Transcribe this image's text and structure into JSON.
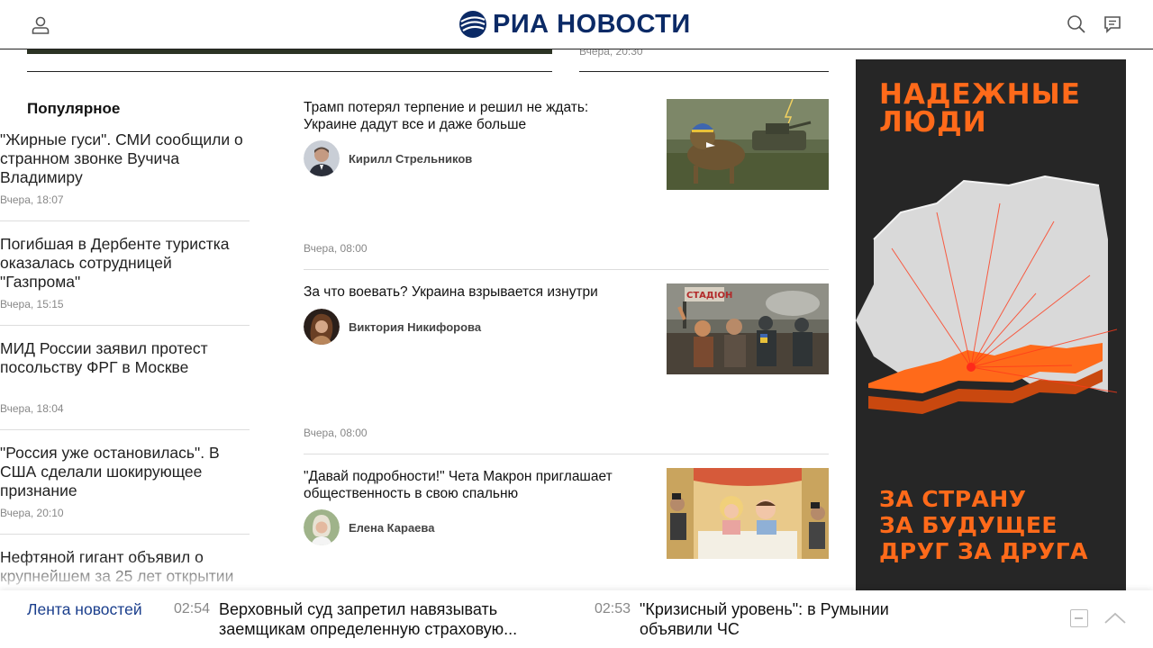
{
  "header": {
    "logo_text": "РИА НОВОСТИ",
    "brand_color": "#0b2a66",
    "icons": [
      "user-icon",
      "search-icon",
      "chat-icon"
    ]
  },
  "previous_row": {
    "time": "Вчера, 20:30"
  },
  "popular": {
    "title": "Популярное",
    "items": [
      {
        "title": "\"Жирные гуси\". СМИ сообщили о странном звонке Вучича Владимиру",
        "time": "Вчера, 18:07"
      },
      {
        "title": "Погибшая в Дербенте туристка оказалась сотрудницей \"Газпрома\"",
        "time": "Вчера, 15:15"
      },
      {
        "title": "МИД России заявил протест посольству ФРГ в Москве",
        "time": "Вчера, 18:04"
      },
      {
        "title": "\"Россия уже остановилась\". В США сделали шокирующее признание",
        "time": "Вчера, 20:10"
      },
      {
        "title": "Нефтяной гигант объявил о крупнейшем за 25 лет открытии",
        "time": ""
      }
    ]
  },
  "news": [
    {
      "title": "Трамп потерял терпение и решил не ждать: Украине дадут все и даже больше",
      "author": "Кирилл Стрельников",
      "time": "Вчера, 08:00"
    },
    {
      "title": "За что воевать? Украина взрывается изнутри",
      "author": "Виктория Никифорова",
      "time": "Вчера, 08:00",
      "image_sign": "СТАДІОН"
    },
    {
      "title": "\"Давай подробности!\" Чета Макрон приглашает общественность в свою спальню",
      "author": "Елена Караева",
      "time": ""
    }
  ],
  "ad": {
    "headline": "НАДЕЖНЫЕ\nЛЮДИ",
    "footer": "ЗА СТРАНУ\nЗА БУДУЩЕЕ\nДРУГ ЗА ДРУГА",
    "accent_color": "#ff6a1a"
  },
  "ticker": {
    "label": "Лента новостей",
    "items": [
      {
        "time": "02:54",
        "text": "Верховный суд запретил навязывать заемщикам определенную страховую..."
      },
      {
        "time": "02:53",
        "text": "\"Кризисный уровень\": в Румынии объявили ЧС"
      }
    ]
  }
}
